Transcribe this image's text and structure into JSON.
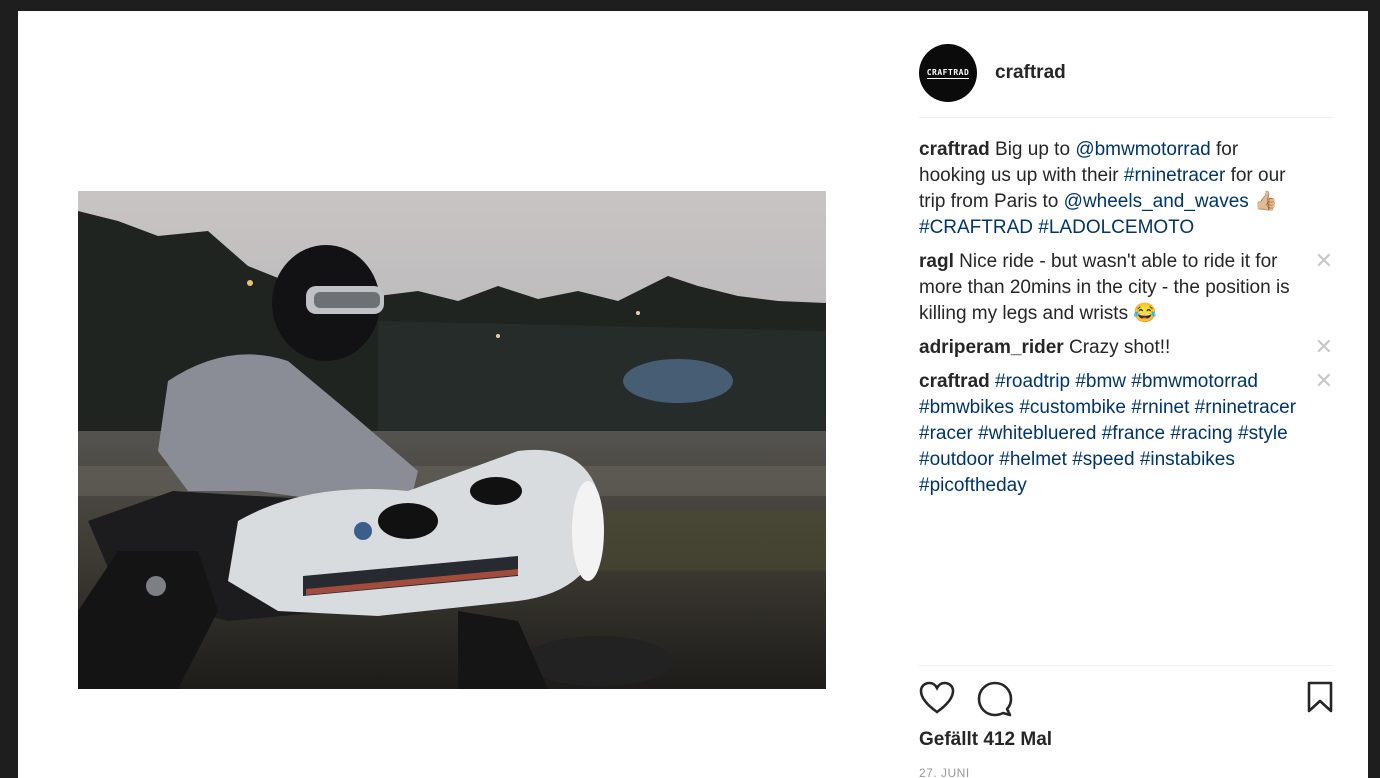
{
  "post": {
    "username": "craftrad",
    "avatar_text": "CRAFTRAD",
    "likes_text": "Gefällt 412 Mal",
    "date": "27. JUNI"
  },
  "comments": [
    {
      "author": "craftrad",
      "parts": [
        {
          "t": " Big up to ",
          "link": false
        },
        {
          "t": "@bmwmotorrad",
          "link": true
        },
        {
          "t": " for hooking us up with their ",
          "link": false
        },
        {
          "t": "#rninetracer",
          "link": true
        },
        {
          "t": " for our trip from Paris to ",
          "link": false
        },
        {
          "t": "@wheels_and_waves",
          "link": true
        },
        {
          "t": " 👍🏼 ",
          "link": false
        },
        {
          "t": "#CRAFTRAD",
          "link": true
        },
        {
          "t": " ",
          "link": false
        },
        {
          "t": "#LADOLCEMOTO",
          "link": true
        }
      ],
      "deletable": false
    },
    {
      "author": "ragl",
      "parts": [
        {
          "t": " Nice ride - but wasn't able to ride it for more than 20mins in the city - the position is killing my legs and wrists 😂",
          "link": false
        }
      ],
      "deletable": true
    },
    {
      "author": "adriperam_rider",
      "parts": [
        {
          "t": " Crazy shot!!",
          "link": false
        }
      ],
      "deletable": true
    },
    {
      "author": "craftrad",
      "parts": [
        {
          "t": " ",
          "link": false
        },
        {
          "t": "#roadtrip",
          "link": true
        },
        {
          "t": " ",
          "link": false
        },
        {
          "t": "#bmw",
          "link": true
        },
        {
          "t": " ",
          "link": false
        },
        {
          "t": "#bmwmotorrad",
          "link": true
        },
        {
          "t": " ",
          "link": false
        },
        {
          "t": "#bmwbikes",
          "link": true
        },
        {
          "t": " ",
          "link": false
        },
        {
          "t": "#custombike",
          "link": true
        },
        {
          "t": " ",
          "link": false
        },
        {
          "t": "#rninet",
          "link": true
        },
        {
          "t": " ",
          "link": false
        },
        {
          "t": "#rninetracer",
          "link": true
        },
        {
          "t": " ",
          "link": false
        },
        {
          "t": "#racer",
          "link": true
        },
        {
          "t": " ",
          "link": false
        },
        {
          "t": "#whitebluered",
          "link": true
        },
        {
          "t": " ",
          "link": false
        },
        {
          "t": "#france",
          "link": true
        },
        {
          "t": " ",
          "link": false
        },
        {
          "t": "#racing",
          "link": true
        },
        {
          "t": " ",
          "link": false
        },
        {
          "t": "#style",
          "link": true
        },
        {
          "t": " ",
          "link": false
        },
        {
          "t": "#outdoor",
          "link": true
        },
        {
          "t": " ",
          "link": false
        },
        {
          "t": "#helmet",
          "link": true
        },
        {
          "t": " ",
          "link": false
        },
        {
          "t": "#speed",
          "link": true
        },
        {
          "t": " ",
          "link": false
        },
        {
          "t": "#instabikes",
          "link": true
        },
        {
          "t": " ",
          "link": false
        },
        {
          "t": "#picoftheday",
          "link": true
        }
      ],
      "deletable": true
    }
  ],
  "icons": {
    "like": "heart-icon",
    "comment": "speech-bubble-icon",
    "save": "bookmark-icon",
    "delete": "close-icon"
  },
  "colors": {
    "link": "#003569",
    "text": "#262626",
    "muted": "#999999"
  }
}
